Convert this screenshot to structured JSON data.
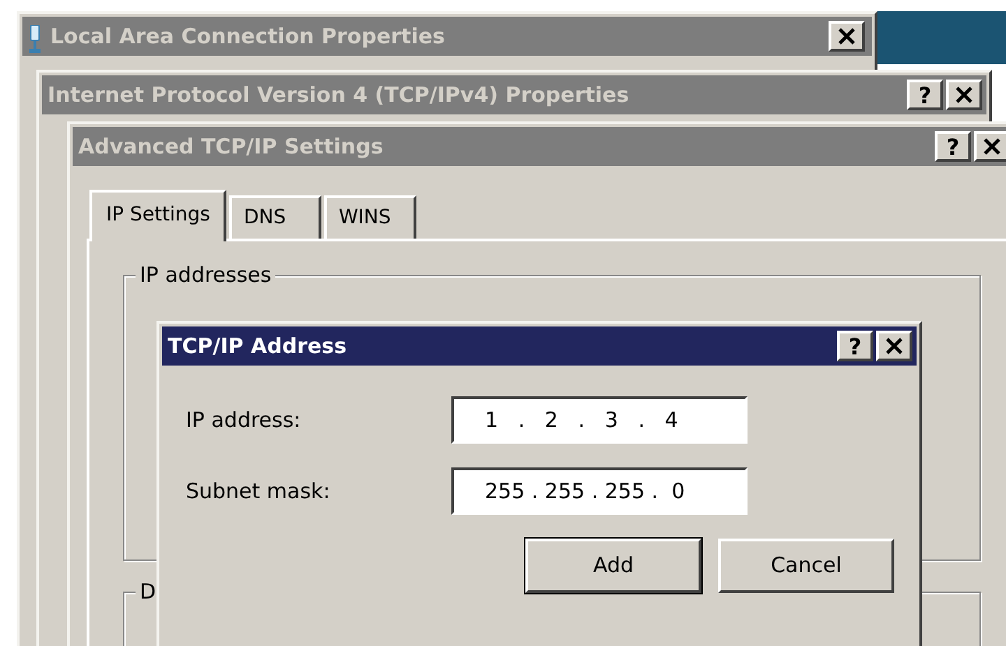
{
  "windows": [
    {
      "title": "Local Area Connection Properties",
      "active": false
    },
    {
      "title": "Internet Protocol Version 4 (TCP/IPv4) Properties",
      "active": false,
      "help": "?"
    },
    {
      "title": "Advanced TCP/IP Settings",
      "active": false,
      "help": "?",
      "tabs": [
        {
          "label": "IP Settings",
          "selected": true
        },
        {
          "label": "DNS",
          "selected": false
        },
        {
          "label": "WINS",
          "selected": false
        }
      ],
      "groups": [
        "IP addresses",
        "D"
      ]
    },
    {
      "title": "TCP/IP Address",
      "active": true,
      "help": "?",
      "fields": [
        {
          "label": "IP address:",
          "value": "1   .   2   .   3   .   4"
        },
        {
          "label": "Subnet mask:",
          "value": "255 . 255 . 255 .  0"
        }
      ],
      "buttons": [
        {
          "label": "Add",
          "default": true
        },
        {
          "label": "Cancel",
          "default": false
        }
      ]
    }
  ]
}
